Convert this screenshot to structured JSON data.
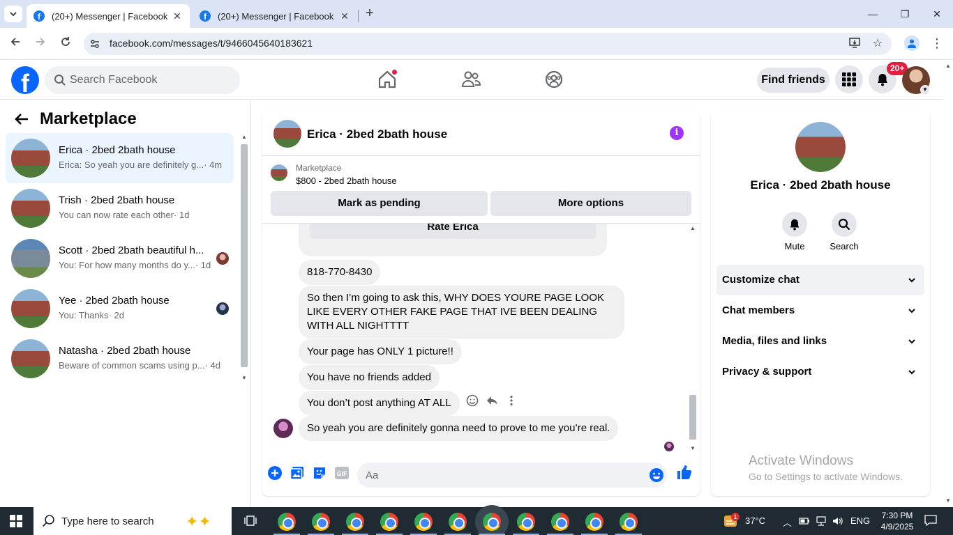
{
  "browser": {
    "tabs": [
      {
        "title": "(20+) Messenger | Facebook",
        "active": true
      },
      {
        "title": "(20+) Messenger | Facebook",
        "active": false
      }
    ],
    "url": "facebook.com/messages/t/9466045640183621"
  },
  "fb_header": {
    "search_placeholder": "Search Facebook",
    "find_friends": "Find friends",
    "notif_badge": "20+"
  },
  "left_panel": {
    "title": "Marketplace",
    "conversations": [
      {
        "name": "Erica · 2bed 2bath house",
        "preview": "Erica: So yeah you are definitely g...",
        "time": "· 4m"
      },
      {
        "name": "Trish · 2bed 2bath house",
        "preview": "You can now rate each other",
        "time": "· 1d"
      },
      {
        "name": "Scott · 2bed 2bath beautiful h...",
        "preview": "You: For how many months do y...",
        "time": "· 1d"
      },
      {
        "name": "Yee · 2bed 2bath house",
        "preview": "You: Thanks",
        "time": "· 2d"
      },
      {
        "name": "Natasha · 2bed 2bath house",
        "preview": "Beware of common scams using p...",
        "time": "· 4d"
      }
    ]
  },
  "chat": {
    "title": "Erica · 2bed 2bath house",
    "marketplace_label": "Marketplace",
    "listing": "$800 - 2bed 2bath house",
    "mark_pending": "Mark as pending",
    "more_options": "More options",
    "rate_button": "Rate Erica",
    "messages": [
      "818-770-8430",
      "So then I’m going to ask this, WHY DOES YOURE PAGE LOOK LIKE EVERY OTHER FAKE PAGE THAT IVE BEEN DEALING WITH ALL NIGHTTTT",
      "Your page has ONLY 1 picture!!",
      "You have no friends added",
      "You don’t post anything AT ALL",
      "So yeah you are definitely gonna need to prove to me you’re real."
    ],
    "composer_placeholder": "Aa"
  },
  "info_panel": {
    "name": "Erica · 2bed 2bath house",
    "actions": [
      {
        "label": "Mute",
        "icon": "bell-icon"
      },
      {
        "label": "Search",
        "icon": "search-icon"
      }
    ],
    "sections": [
      "Customize chat",
      "Chat members",
      "Media, files and links",
      "Privacy & support"
    ]
  },
  "watermark": {
    "line1": "Activate Windows",
    "line2": "Go to Settings to activate Windows."
  },
  "taskbar": {
    "search_placeholder": "Type here to search",
    "temperature": "37°C",
    "weather_badge": "1",
    "language": "ENG",
    "time": "7:30 PM",
    "date": "4/9/2025"
  },
  "colors": {
    "fb_blue": "#0866ff",
    "messenger_purple": "#a033ff",
    "selected_row": "#ebf5ff",
    "bubble_gray": "#f0f0f0",
    "badge_red": "#e41e3f"
  }
}
